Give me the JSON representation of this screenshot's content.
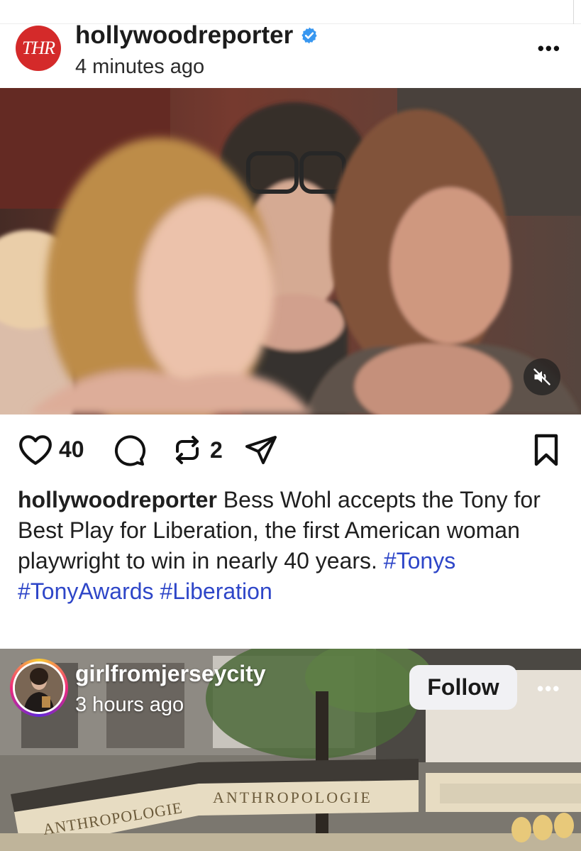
{
  "post1": {
    "username": "hollywoodreporter",
    "logo_text": "THR",
    "timestamp": "4 minutes ago",
    "more_label": "•••",
    "actions": {
      "like_count": "40",
      "repost_count": "2"
    },
    "caption": {
      "username": "hollywoodreporter",
      "text": " Bess Wohl accepts the Tony for Best Play for Liberation, the first American woman playwright to win in nearly 40 years. ",
      "hashtags": [
        "#Tonys",
        "#TonyAwards",
        "#Liberation"
      ]
    },
    "icons": {
      "verified": "verified-badge-icon",
      "like": "heart-icon",
      "comment": "comment-icon",
      "repost": "repost-icon",
      "share": "send-icon",
      "save": "bookmark-icon",
      "mute": "speaker-muted-icon"
    }
  },
  "post2": {
    "username": "girlfromjerseycity",
    "timestamp": "3 hours ago",
    "follow_label": "Follow",
    "more_label": "•••",
    "sign_left": "ANTHROPOLOGIE",
    "sign_center": "ANTHROPOLOGIE"
  },
  "colors": {
    "hashtag": "#2e46c8",
    "thr_red": "#d42a2a",
    "verified_blue": "#3897f0"
  }
}
